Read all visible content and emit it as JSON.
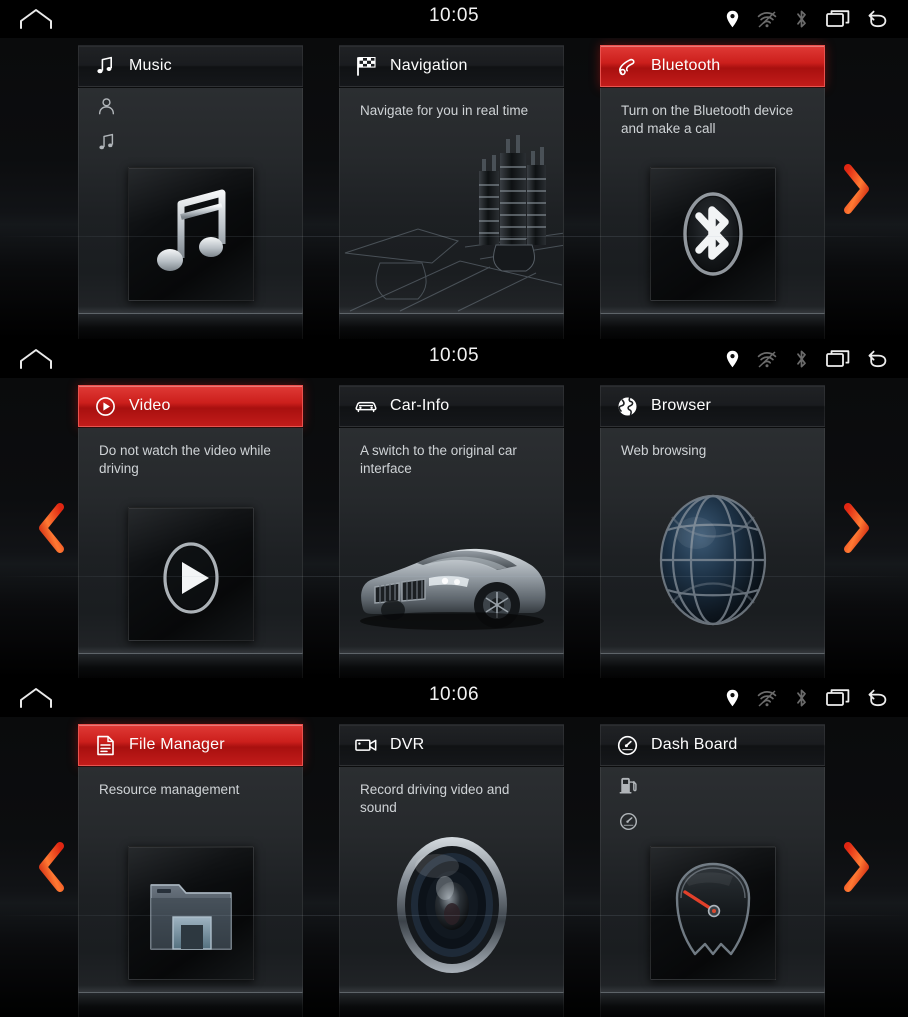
{
  "statusbar": {
    "home_icon": "home-icon",
    "icons": [
      {
        "name": "location-icon",
        "state": "active"
      },
      {
        "name": "wifi-icon",
        "state": "dim"
      },
      {
        "name": "bluetooth-icon",
        "state": "dim"
      },
      {
        "name": "recents-icon",
        "state": "active"
      },
      {
        "name": "back-icon",
        "state": "active"
      }
    ]
  },
  "colors": {
    "accent_red": "#cc1f1c",
    "accent_red_light": "#e03a36",
    "arrow_red": "#e8351d",
    "arrow_orange": "#ff8a3d",
    "card_bg": "#26292c",
    "header_bg": "#1a1c1f",
    "text_primary": "#fdfdfd",
    "text_secondary": "#cfd3d6",
    "screen_bg": "#000000"
  },
  "screens": [
    {
      "id": "screen-1",
      "time": "10:05",
      "arrow_left": false,
      "arrow_right": true,
      "cards": [
        {
          "title": "Music",
          "icon": "music-note-icon",
          "active": false,
          "desc": "",
          "mini_icons": [
            "artist-icon",
            "music-note-icon"
          ],
          "art": "music-note-art"
        },
        {
          "title": "Navigation",
          "icon": "checkered-flag-icon",
          "active": false,
          "desc": "Navigate for you in real time",
          "mini_icons": [],
          "art": "navigation-cityscape-art"
        },
        {
          "title": "Bluetooth",
          "icon": "phone-handset-icon",
          "active": true,
          "desc": "Turn on the Bluetooth device and make a call",
          "mini_icons": [],
          "art": "bluetooth-art"
        }
      ]
    },
    {
      "id": "screen-2",
      "time": "10:05",
      "arrow_left": true,
      "arrow_right": true,
      "cards": [
        {
          "title": "Video",
          "icon": "play-circle-icon",
          "active": true,
          "desc": "Do not watch the video while driving",
          "mini_icons": [],
          "art": "play-button-art"
        },
        {
          "title": "Car-Info",
          "icon": "car-front-icon",
          "active": false,
          "desc": "A switch to the original car interface",
          "mini_icons": [],
          "art": "sedan-car-art"
        },
        {
          "title": "Browser",
          "icon": "globe-icon",
          "active": false,
          "desc": "Web browsing",
          "mini_icons": [],
          "art": "globe-sphere-art"
        }
      ]
    },
    {
      "id": "screen-3",
      "time": "10:06",
      "arrow_left": true,
      "arrow_right": true,
      "cards": [
        {
          "title": "File Manager",
          "icon": "document-lines-icon",
          "active": true,
          "desc": "Resource management",
          "mini_icons": [],
          "art": "folder-drive-art"
        },
        {
          "title": "DVR",
          "icon": "video-camera-icon",
          "active": false,
          "desc": "Record driving video and sound",
          "mini_icons": [],
          "art": "camera-lens-art"
        },
        {
          "title": "Dash Board",
          "icon": "gauge-circle-icon",
          "active": false,
          "desc": "",
          "mini_icons": [
            "fuel-pump-icon",
            "gauge-icon"
          ],
          "art": "speedometer-art"
        }
      ]
    }
  ]
}
